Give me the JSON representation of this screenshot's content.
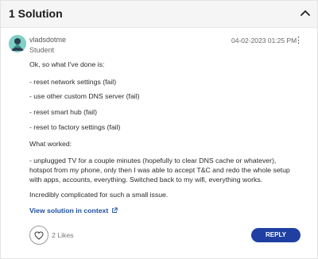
{
  "header": {
    "title": "1 Solution",
    "collapse_icon": "chevron-up-icon"
  },
  "post": {
    "author": {
      "username": "vladsdotme",
      "role": "Student",
      "avatar": "avatar-icon"
    },
    "timestamp": "04-02-2023 01:25 PM",
    "menu_icon": "kebab-menu-icon",
    "paragraphs": [
      "Ok, so what I've done is:",
      "- reset network settings (fail)",
      "- use other custom DNS server (fail)",
      "- reset smart hub (fail)",
      "- reset to factory settings (fail)",
      "What worked:",
      "- unplugged TV for a couple minutes (hopefully to clear DNS cache or whatever), hotspot from my phone, only then I was able to accept T&C and redo the whole setup with apps, accounts, everything. Switched back to my wifi, everything works.",
      "Incredibly complicated for such a small issue."
    ],
    "view_solution_label": "View solution in context",
    "likes_label": "2 Likes",
    "reply_label": "REPLY"
  },
  "colors": {
    "accent": "#1f3fa3",
    "link": "#1f4fa0",
    "header_bg": "#f5f5f5",
    "avatar": "#7fd0c6"
  }
}
